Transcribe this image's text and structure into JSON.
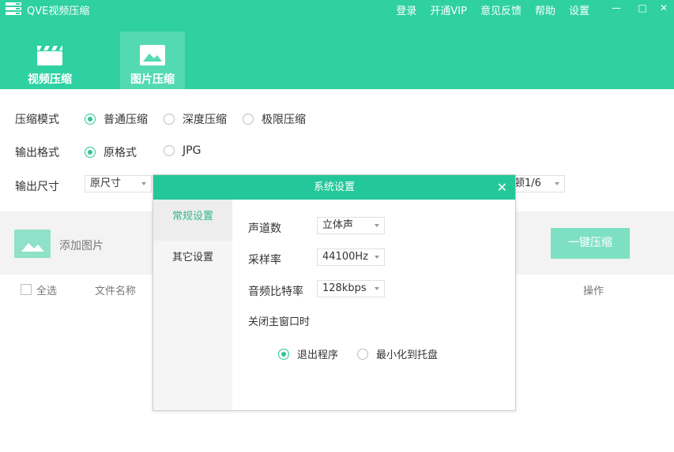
{
  "app": {
    "title": "QVE视频压缩",
    "logo_icon": "menu-stack-icon"
  },
  "top_menu": [
    {
      "label": "登录"
    },
    {
      "label": "开通VIP"
    },
    {
      "label": "意见反馈"
    },
    {
      "label": "帮助"
    },
    {
      "label": "设置"
    }
  ],
  "window_controls": {
    "minimize": "—",
    "maximize": "□",
    "close": "✕"
  },
  "tabs": [
    {
      "label": "视频压缩",
      "icon": "clapperboard-icon",
      "active": false
    },
    {
      "label": "图片压缩",
      "icon": "image-icon",
      "active": true
    }
  ],
  "settings": {
    "mode": {
      "label": "压缩模式",
      "options": [
        {
          "label": "普通压缩",
          "checked": true
        },
        {
          "label": "深度压缩",
          "checked": false
        },
        {
          "label": "极限压缩",
          "checked": false
        }
      ]
    },
    "format": {
      "label": "输出格式",
      "options": [
        {
          "label": "原格式",
          "checked": true
        },
        {
          "label": "JPG",
          "checked": false
        }
      ]
    },
    "size": {
      "label": "输出尺寸",
      "value": "原尺寸",
      "right_select_value": "顿1/6"
    }
  },
  "add_area": {
    "add_label": "添加图片",
    "compress_button": "一键压缩"
  },
  "list_header": {
    "select_all": "全选",
    "file_name": "文件名称",
    "action": "操作"
  },
  "dialog": {
    "title": "系统设置",
    "close": "✕",
    "side_items": [
      {
        "label": "常规设置",
        "active": true
      },
      {
        "label": "其它设置",
        "active": false
      }
    ],
    "fields": {
      "channels": {
        "label": "声道数",
        "value": "立体声"
      },
      "sample_rate": {
        "label": "采样率",
        "value": "44100Hz"
      },
      "bitrate": {
        "label": "音频比特率",
        "value": "128kbps"
      },
      "on_close": {
        "label": "关闭主窗口时"
      }
    },
    "close_options": [
      {
        "label": "退出程序",
        "checked": true
      },
      {
        "label": "最小化到托盘",
        "checked": false
      }
    ]
  },
  "colors": {
    "accent": "#2fd0a1",
    "dialog_header": "#24c799",
    "button_light": "#7ee0c2"
  }
}
